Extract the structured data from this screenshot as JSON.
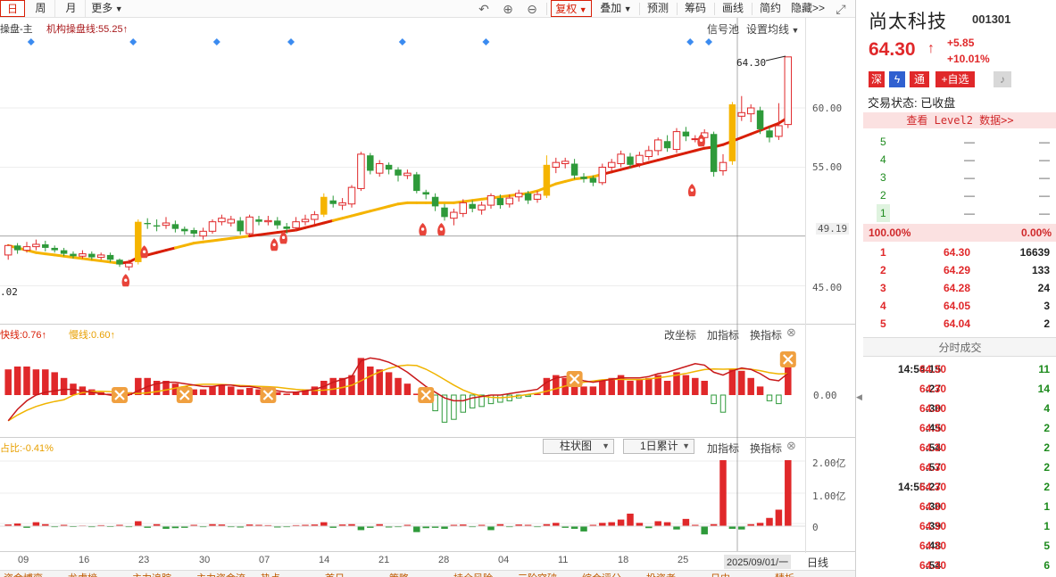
{
  "toolbar": {
    "periods": [
      "日",
      "周",
      "月"
    ],
    "more_label": "更多",
    "undo_icon": "undo-icon",
    "zoom_in_icon": "zoom-in-icon",
    "zoom_out_icon": "zoom-out-icon",
    "fuquan_label": "复权",
    "overlay_label": "叠加",
    "predict_label": "预测",
    "grid_label": "筹码",
    "draw_label": "画线",
    "simple_label": "简约",
    "hide_label": "隐藏>>",
    "fullscreen_icon": "fullscreen-icon"
  },
  "main_chart": {
    "indicator_name": "操盘-主",
    "indicator_line": "机构操盘线:55.25",
    "signal_pool": "信号池",
    "set_ma": "设置均线",
    "high_label": "64.30",
    "crosshair_price": "49.19",
    "low_label": ".02",
    "price_ticks": [
      "60.00",
      "55.00",
      "45.00"
    ]
  },
  "macd_panel": {
    "fast_label": "快线:0.76",
    "slow_label": "慢线:0.60",
    "change_coord": "改坐标",
    "add_indicator": "加指标",
    "change_indicator": "换指标",
    "zero_tick": "0.00"
  },
  "volume_panel": {
    "ratio_label": "占比:-0.41%",
    "mode_select": "柱状图",
    "period_select": "1日累计",
    "add_indicator": "加指标",
    "change_indicator": "换指标",
    "vol_ticks": [
      "2.00亿",
      "1.00亿",
      "0"
    ]
  },
  "x_axis": {
    "ticks": [
      "09",
      "16",
      "23",
      "30",
      "07",
      "14",
      "21",
      "28",
      "04",
      "11",
      "18",
      "25"
    ],
    "crosshair_date": "2025/09/01/一",
    "period_label": "日线"
  },
  "bottom_tabs": [
    "资金博弈",
    "龙虎榜",
    "主力追踪",
    "主力资金流",
    "热点",
    "首日",
    "策略",
    "持仓风险",
    "三阶突破",
    "综合评分",
    "投资者",
    "日内",
    "精析"
  ],
  "quote": {
    "name": "尚太科技",
    "code": "001301",
    "price": "64.30",
    "change": "+5.85",
    "change_pct": "+10.01%",
    "badges": [
      "深",
      "通",
      "+自选"
    ],
    "status_label": "交易状态: 已收盘",
    "level2_label": "查看 Level2 数据>>",
    "ask_levels": [
      {
        "level": "5",
        "price": "—",
        "volume": "—"
      },
      {
        "level": "4",
        "price": "—",
        "volume": "—"
      },
      {
        "level": "3",
        "price": "—",
        "volume": "—"
      },
      {
        "level": "2",
        "price": "—",
        "volume": "—"
      },
      {
        "level": "1",
        "price": "—",
        "volume": "—"
      }
    ],
    "buy_ratio": "100.00%",
    "sell_ratio": "0.00%",
    "bid_levels": [
      {
        "level": "1",
        "price": "64.30",
        "volume": "16639"
      },
      {
        "level": "2",
        "price": "64.29",
        "volume": "133"
      },
      {
        "level": "3",
        "price": "64.28",
        "volume": "24"
      },
      {
        "level": "4",
        "price": "64.05",
        "volume": "3"
      },
      {
        "level": "5",
        "price": "64.04",
        "volume": "2"
      }
    ],
    "ticks_header": "分时成交",
    "ticks": [
      {
        "time": "14:54:15",
        "price": "64.30",
        "volume": "11"
      },
      {
        "time": ":27",
        "price": "64.30",
        "volume": "14"
      },
      {
        "time": ":30",
        "price": "64.30",
        "volume": "4"
      },
      {
        "time": ":45",
        "price": "64.30",
        "volume": "2"
      },
      {
        "time": ":54",
        "price": "64.30",
        "volume": "2"
      },
      {
        "time": ":57",
        "price": "64.30",
        "volume": "2"
      },
      {
        "time": "14:55:27",
        "price": "64.30",
        "volume": "2"
      },
      {
        "time": ":30",
        "price": "64.30",
        "volume": "1"
      },
      {
        "time": ":39",
        "price": "64.30",
        "volume": "1"
      },
      {
        "time": ":48",
        "price": "64.30",
        "volume": "5"
      },
      {
        "time": ":54",
        "price": "64.30",
        "volume": "6"
      }
    ]
  },
  "colors": {
    "up": "#e0282a",
    "down": "#2e9a3a",
    "yellow": "#f5b400",
    "slow_line": "#f0b400",
    "fast_line": "#d81e06"
  },
  "chart_data": {
    "type": "candlestick",
    "title": "",
    "x_ticks": [
      "09",
      "16",
      "23",
      "30",
      "07",
      "14",
      "21",
      "28",
      "04",
      "11",
      "18",
      "25"
    ],
    "price_range": [
      42.0,
      66.0
    ],
    "candles": [
      [
        47.6,
        48.4,
        47.2,
        48.5
      ],
      [
        48.4,
        48.0,
        47.7,
        48.6
      ],
      [
        48.0,
        48.3,
        47.8,
        48.7
      ],
      [
        48.3,
        48.5,
        48.0,
        48.9
      ],
      [
        48.5,
        48.2,
        47.9,
        48.8
      ],
      [
        48.2,
        48.0,
        47.8,
        48.4
      ],
      [
        48.0,
        47.7,
        47.5,
        48.2
      ],
      [
        47.7,
        47.5,
        47.3,
        47.9
      ],
      [
        47.5,
        47.7,
        47.3,
        48.0
      ],
      [
        47.7,
        47.4,
        47.2,
        47.9
      ],
      [
        47.4,
        47.6,
        47.2,
        47.8
      ],
      [
        47.6,
        47.2,
        47.0,
        47.8
      ],
      [
        47.2,
        46.8,
        46.6,
        47.3
      ],
      [
        46.6,
        46.9,
        46.3,
        47.2
      ],
      [
        47.0,
        50.4,
        46.8,
        50.6
      ],
      [
        50.3,
        50.2,
        49.8,
        50.7
      ],
      [
        50.1,
        50.0,
        49.6,
        50.6
      ],
      [
        50.1,
        50.3,
        49.8,
        50.8
      ],
      [
        50.2,
        49.8,
        49.5,
        50.5
      ],
      [
        49.8,
        49.6,
        49.3,
        50.0
      ],
      [
        49.7,
        49.4,
        49.1,
        49.9
      ],
      [
        49.2,
        49.6,
        48.9,
        49.9
      ],
      [
        49.6,
        50.4,
        49.4,
        50.6
      ],
      [
        50.4,
        50.7,
        50.1,
        51.0
      ],
      [
        50.3,
        50.6,
        50.0,
        50.9
      ],
      [
        50.5,
        49.6,
        49.3,
        50.8
      ],
      [
        49.4,
        50.8,
        49.2,
        51.0
      ],
      [
        50.6,
        50.4,
        50.1,
        50.9
      ],
      [
        50.4,
        50.5,
        50.1,
        50.9
      ],
      [
        50.5,
        50.1,
        49.8,
        50.8
      ],
      [
        50.0,
        49.8,
        49.4,
        50.3
      ],
      [
        49.9,
        50.4,
        49.6,
        50.8
      ],
      [
        50.4,
        50.6,
        50.1,
        51.0
      ],
      [
        50.6,
        51.0,
        50.2,
        51.3
      ],
      [
        51.0,
        52.5,
        50.8,
        52.8
      ],
      [
        52.2,
        51.9,
        51.6,
        52.6
      ],
      [
        51.8,
        52.0,
        51.4,
        52.4
      ],
      [
        51.9,
        53.3,
        51.6,
        53.5
      ],
      [
        53.2,
        56.1,
        53.0,
        56.3
      ],
      [
        56.0,
        54.7,
        54.4,
        56.2
      ],
      [
        54.5,
        55.3,
        54.2,
        55.6
      ],
      [
        55.2,
        54.8,
        54.4,
        55.4
      ],
      [
        54.8,
        54.3,
        53.8,
        55.0
      ],
      [
        54.3,
        54.5,
        54.0,
        54.8
      ],
      [
        54.4,
        53.0,
        52.8,
        54.6
      ],
      [
        52.9,
        52.7,
        52.3,
        53.1
      ],
      [
        52.5,
        51.7,
        51.3,
        52.8
      ],
      [
        51.6,
        50.8,
        50.5,
        51.9
      ],
      [
        50.7,
        51.2,
        50.1,
        51.5
      ],
      [
        51.1,
        52.0,
        50.8,
        52.3
      ],
      [
        51.9,
        51.5,
        51.2,
        52.2
      ],
      [
        51.4,
        51.8,
        51.0,
        52.1
      ],
      [
        51.8,
        52.6,
        51.5,
        52.8
      ],
      [
        52.4,
        51.8,
        51.5,
        52.7
      ],
      [
        51.9,
        52.4,
        51.6,
        52.7
      ],
      [
        52.5,
        52.8,
        52.1,
        53.1
      ],
      [
        52.8,
        52.2,
        51.9,
        53.0
      ],
      [
        52.3,
        52.7,
        52.0,
        53.0
      ],
      [
        52.6,
        55.2,
        52.4,
        56.0
      ],
      [
        55.0,
        55.4,
        54.5,
        55.8
      ],
      [
        55.3,
        55.5,
        54.9,
        55.8
      ],
      [
        55.3,
        54.3,
        54.0,
        55.7
      ],
      [
        54.2,
        54.0,
        53.7,
        54.5
      ],
      [
        54.1,
        53.7,
        53.4,
        54.3
      ],
      [
        53.7,
        55.0,
        53.5,
        55.3
      ],
      [
        55.0,
        55.4,
        54.7,
        55.7
      ],
      [
        55.3,
        56.1,
        55.0,
        56.4
      ],
      [
        55.9,
        55.2,
        54.9,
        56.2
      ],
      [
        55.3,
        56.0,
        55.0,
        56.3
      ],
      [
        55.9,
        56.4,
        55.6,
        56.8
      ],
      [
        56.4,
        57.3,
        56.0,
        57.5
      ],
      [
        57.2,
        56.6,
        56.3,
        57.7
      ],
      [
        56.5,
        58.0,
        56.2,
        58.3
      ],
      [
        58.0,
        57.6,
        57.2,
        58.4
      ],
      [
        57.4,
        57.4,
        57.1,
        57.7
      ],
      [
        57.5,
        57.9,
        57.2,
        58.2
      ],
      [
        57.8,
        54.6,
        54.2,
        58.0
      ],
      [
        54.7,
        55.4,
        54.3,
        56.1
      ],
      [
        55.5,
        60.3,
        55.2,
        60.5
      ],
      [
        59.3,
        59.6,
        58.9,
        61.0
      ],
      [
        59.5,
        60.0,
        58.8,
        60.3
      ],
      [
        59.8,
        58.2,
        57.8,
        60.1
      ],
      [
        58.1,
        57.5,
        57.1,
        58.4
      ],
      [
        57.6,
        58.5,
        57.3,
        60.4
      ],
      [
        58.6,
        64.3,
        58.3,
        64.3
      ]
    ],
    "slow_line": [
      48.4,
      48.2,
      48.0,
      47.8,
      47.7,
      47.6,
      47.5,
      47.4,
      47.3,
      47.2,
      47.1,
      47.0,
      46.9,
      47.0,
      47.4,
      47.6,
      47.8,
      48.0,
      48.2,
      48.4,
      48.6,
      48.7,
      48.8,
      48.9,
      49.0,
      49.1,
      49.2,
      49.3,
      49.4,
      49.5,
      49.6,
      49.7,
      49.9,
      50.1,
      50.3,
      50.5,
      50.7,
      50.9,
      51.1,
      51.3,
      51.5,
      51.7,
      51.9,
      52.0,
      52.0,
      52.0,
      52.0,
      52.0,
      52.0,
      52.1,
      52.2,
      52.3,
      52.4,
      52.5,
      52.6,
      52.7,
      52.8,
      53.0,
      53.3,
      53.6,
      53.8,
      54.0,
      54.1,
      54.2,
      54.4,
      54.6,
      54.8,
      55.0,
      55.2,
      55.4,
      55.6,
      55.8,
      56.0,
      56.2,
      56.4,
      56.6,
      56.7,
      56.9,
      57.2,
      57.5,
      57.8,
      58.1,
      58.4,
      58.7,
      59.2
    ]
  }
}
